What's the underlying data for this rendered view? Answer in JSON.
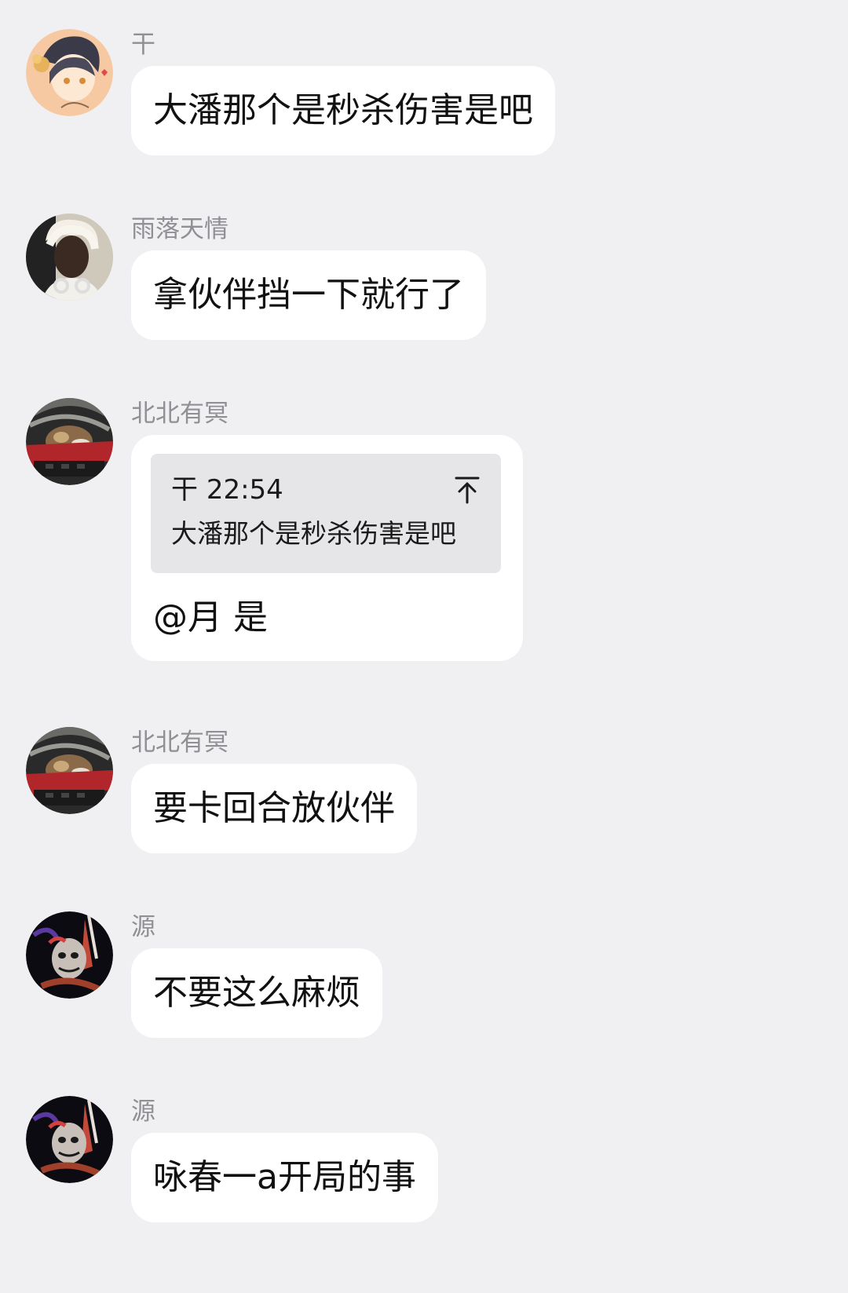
{
  "messages": [
    {
      "sender": "干",
      "avatar": "anime-girl-avatar",
      "text": "大潘那个是秒杀伤害是吧"
    },
    {
      "sender": "雨落天情",
      "avatar": "person-white-hair-avatar",
      "text": "拿伙伴挡一下就行了"
    },
    {
      "sender": "北北有冥",
      "avatar": "cat-avatar",
      "quote": {
        "sender": "干",
        "time": "22:54",
        "text": "大潘那个是秒杀伤害是吧",
        "icon": "jump-to-top-icon"
      },
      "text": "@月 是"
    },
    {
      "sender": "北北有冥",
      "avatar": "cat-avatar",
      "text": "要卡回合放伙伴"
    },
    {
      "sender": "源",
      "avatar": "dark-art-avatar",
      "text": "不要这么麻烦"
    },
    {
      "sender": "源",
      "avatar": "dark-art-avatar",
      "text": "咏春一a开局的事"
    }
  ],
  "colors": {
    "background": "#f0f0f2",
    "bubble": "#ffffff",
    "quote_background": "#e6e6e8",
    "sender_name": "#8f8f94",
    "message_text": "#111111"
  }
}
